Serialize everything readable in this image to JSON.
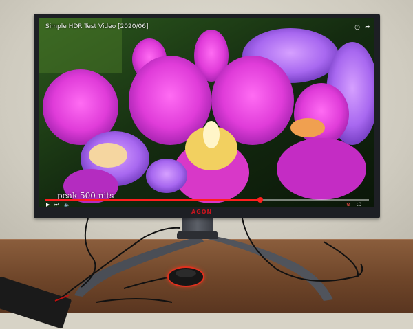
{
  "video": {
    "title": "Simple HDR Test Video [2020/06]",
    "overlay_caption": "peak 500 nits",
    "progress": 0.665
  },
  "monitor": {
    "brand": "AGON"
  },
  "icons": {
    "top_right": [
      "clock-icon",
      "share-icon"
    ],
    "controls_left": [
      "play-icon",
      "next-icon",
      "volume-icon"
    ],
    "controls_right": [
      "settings-icon",
      "fullscreen-icon"
    ]
  },
  "colors": {
    "progress": "#ff1e1e",
    "brand": "#c9141e",
    "puck_ring": "#e0301e"
  }
}
